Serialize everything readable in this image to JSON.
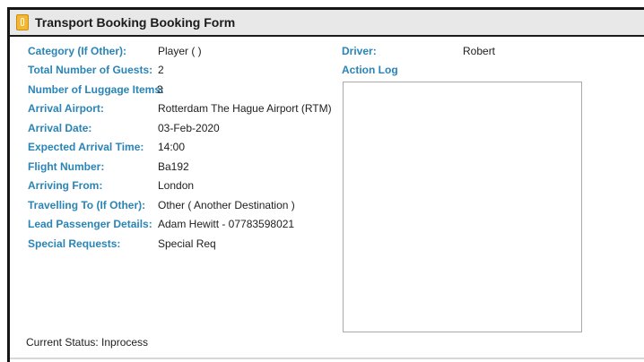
{
  "window": {
    "title": "Transport Booking Booking Form",
    "icon": "form-icon"
  },
  "fields": [
    {
      "label": "Category (If Other):",
      "value": "Player ( )"
    },
    {
      "label": "Total Number of Guests:",
      "value": "2"
    },
    {
      "label": "Number of Luggage Items:",
      "value": "3"
    },
    {
      "label": "Arrival Airport:",
      "value": "Rotterdam The Hague Airport (RTM)"
    },
    {
      "label": "Arrival Date:",
      "value": "03-Feb-2020"
    },
    {
      "label": "Expected Arrival Time:",
      "value": "14:00"
    },
    {
      "label": "Flight Number:",
      "value": "Ba192"
    },
    {
      "label": "Arriving From:",
      "value": "London"
    },
    {
      "label": "Travelling To (If Other):",
      "value": "Other ( Another Destination )"
    },
    {
      "label": "Lead Passenger Details:",
      "value": "Adam Hewitt - 07783598021"
    },
    {
      "label": "Special Requests:",
      "value": "Special Req"
    }
  ],
  "driver": {
    "label": "Driver:",
    "value": "Robert"
  },
  "action_log": {
    "label": "Action Log",
    "value": ""
  },
  "status": {
    "text": "Current Status: Inprocess"
  },
  "colors": {
    "label": "#2a84b6",
    "text": "#1d1d1d",
    "titlebar": "#e8e8e8"
  }
}
